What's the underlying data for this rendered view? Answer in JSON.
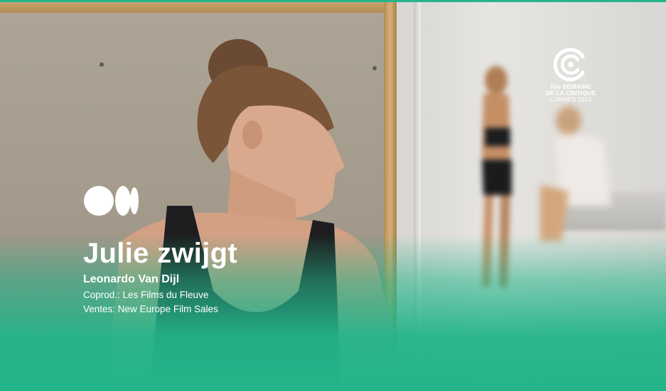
{
  "film": {
    "title": "Julie zwijgt",
    "director": "Leonardo Van Dijl",
    "coproduction": "Coprod.: Les Films du Fleuve",
    "sales": "Ventes: New Europe Film Sales"
  },
  "festival_badge": {
    "line1": "63e SEMAINE",
    "line2": "DE LA CRITIQUE",
    "line3": "CANNES 2024",
    "icon": "critics-week-logo-icon"
  },
  "brand_logo": {
    "icon": "brand-logo-icon"
  },
  "colors": {
    "accent_green": "#24b48a",
    "text": "#ffffff"
  }
}
